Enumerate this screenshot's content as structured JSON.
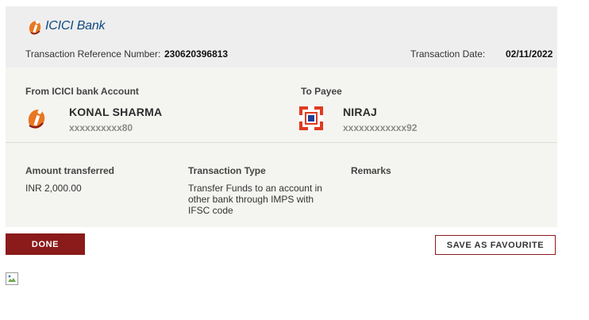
{
  "brand": {
    "logo_text": "ICICI Bank",
    "accent": "#8b1a1a",
    "brand_blue": "#0f4a83"
  },
  "header": {
    "ref_label": "Transaction Reference Number:",
    "ref_value": "230620396813",
    "date_label": "Transaction Date:",
    "date_value": "02/11/2022"
  },
  "from": {
    "title": "From ICICI bank Account",
    "name": "KONAL SHARMA",
    "account": "xxxxxxxxxx80",
    "icon": "icici-bank-icon"
  },
  "to": {
    "title": "To Payee",
    "name": "NIRAJ",
    "account": "xxxxxxxxxxxx92",
    "icon": "payee-bank-icon"
  },
  "details": {
    "amount_label": "Amount transferred",
    "amount_value": "INR 2,000.00",
    "type_label": "Transaction Type",
    "type_value": "Transfer Funds to an account in other bank through IMPS with IFSC code",
    "remarks_label": "Remarks",
    "remarks_value": ""
  },
  "actions": {
    "done_label": "DONE",
    "favourite_label": "SAVE AS FAVOURITE"
  },
  "footer": {
    "image_icon": "broken-image-icon"
  }
}
